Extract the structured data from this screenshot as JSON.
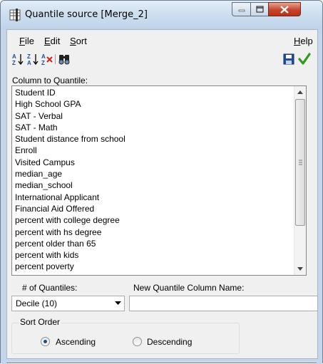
{
  "window": {
    "title": "Quantile source  [Merge_2]"
  },
  "menu": {
    "file": {
      "mnemonic": "F",
      "rest": "ile"
    },
    "edit": {
      "mnemonic": "E",
      "rest": "dit"
    },
    "sort": {
      "mnemonic": "S",
      "rest": "ort"
    },
    "help": {
      "mnemonic": "H",
      "rest": "elp"
    }
  },
  "toolbar": {
    "icons": [
      "sort-ascending-icon",
      "sort-descending-icon",
      "clear-sort-icon",
      "find-icon",
      "save-icon",
      "ok-checkmark-icon"
    ]
  },
  "column_label": "Column to Quantile:",
  "columns": [
    "Student ID",
    "High School GPA",
    "SAT - Verbal",
    "SAT - Math",
    "Student distance from school",
    "Enroll",
    "Visited Campus",
    "median_age",
    "median_school",
    "International Applicant",
    "Financial Aid Offered",
    "percent with college degree",
    "percent with hs degree",
    "percent older than 65",
    "percent with kids",
    "percent poverty"
  ],
  "quantiles": {
    "label": "# of Quantiles:",
    "selected": "Decile (10)"
  },
  "new_column": {
    "label": "New Quantile Column Name:",
    "value": ""
  },
  "sort_order": {
    "title": "Sort Order",
    "ascending_label": "Ascending",
    "descending_label": "Descending",
    "selected": "Ascending"
  },
  "colors": {
    "titlebar": "#cfdff0",
    "close_button": "#c7432c",
    "check_green": "#2f9a1e",
    "save_blue": "#1f4e9c"
  }
}
